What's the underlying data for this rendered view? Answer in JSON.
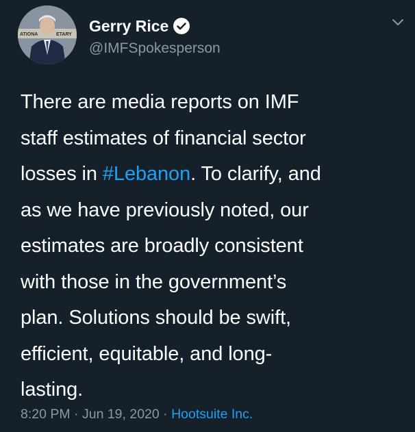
{
  "author": {
    "display_name": "Gerry Rice",
    "handle": "@IMFSpokesperson",
    "verified": true,
    "avatar_icon": "profile-photo",
    "avatar_banner_left": "ATIONA",
    "avatar_banner_right": "ETARY"
  },
  "tweet": {
    "line1": "There are media reports on IMF",
    "line2": "staff estimates of financial sector",
    "line3_pre": "losses in ",
    "hashtag": "#Lebanon",
    "line3_post": ". To clarify, and",
    "line4": "as we have previously noted, our",
    "line5": "estimates are broadly consistent",
    "line6": "with those in the government’s",
    "line7": "plan. Solutions should be swift,",
    "line8": "efficient, equitable, and long-",
    "line9": "lasting."
  },
  "meta": {
    "time": "8:20 PM",
    "separator": " · ",
    "date": "Jun 19, 2020",
    "source": "Hootsuite Inc."
  },
  "colors": {
    "background": "#15202b",
    "text": "#ffffff",
    "muted": "#8899a6",
    "accent": "#1da1f2"
  },
  "icons": {
    "verified": "verified-badge-icon",
    "menu": "chevron-down-icon"
  }
}
